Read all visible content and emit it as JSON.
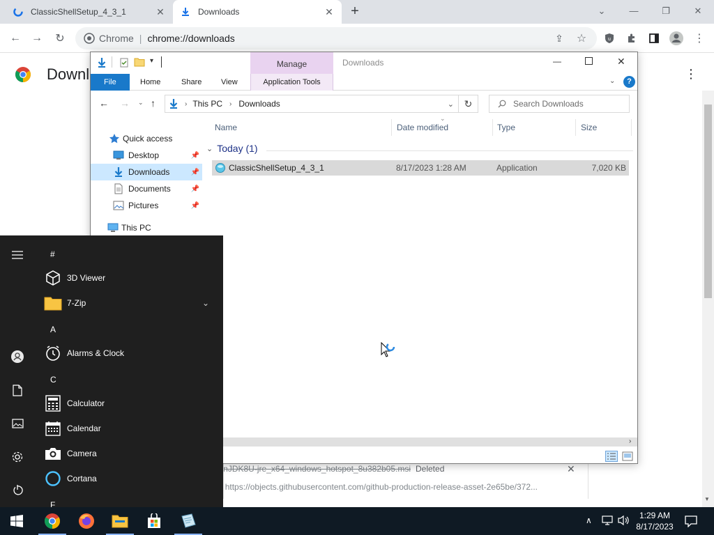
{
  "browser": {
    "tabs": [
      {
        "title": "ClassicShellSetup_4_3_1",
        "icon": "edge-spinner-icon",
        "active": false
      },
      {
        "title": "Downloads",
        "icon": "download-arrow-icon",
        "active": true
      }
    ],
    "new_tab_label": "+",
    "omnibox": {
      "site": "Chrome",
      "url": "chrome://downloads"
    },
    "page_title": "Downloads",
    "download_item": {
      "filename": "OpenJDK8U-jre_x64_windows_hotspot_8u382b05.msi",
      "status": "Deleted",
      "url": "https://objects.githubusercontent.com/github-production-release-asset-2e65be/372..."
    }
  },
  "explorer": {
    "manage_tab": "Manage",
    "title": "Downloads",
    "ribbon_tabs": [
      "File",
      "Home",
      "Share",
      "View",
      "Application Tools"
    ],
    "breadcrumb": [
      "This PC",
      "Downloads"
    ],
    "search_placeholder": "Search Downloads",
    "nav": [
      {
        "label": "Quick access",
        "icon": "star-icon",
        "pinned": false
      },
      {
        "label": "Desktop",
        "icon": "desktop-folder-icon",
        "pinned": true
      },
      {
        "label": "Downloads",
        "icon": "downloads-folder-icon",
        "pinned": true,
        "selected": true
      },
      {
        "label": "Documents",
        "icon": "documents-folder-icon",
        "pinned": true
      },
      {
        "label": "Pictures",
        "icon": "pictures-folder-icon",
        "pinned": true
      },
      {
        "label": "This PC",
        "icon": "computer-icon",
        "pinned": false
      }
    ],
    "columns": [
      "Name",
      "Date modified",
      "Type",
      "Size"
    ],
    "group": "Today (1)",
    "files": [
      {
        "name": "ClassicShellSetup_4_3_1",
        "date": "8/17/2023 1:28 AM",
        "type": "Application",
        "size": "7,020 KB"
      }
    ]
  },
  "start_menu": {
    "sections": [
      {
        "letter": "#",
        "apps": [
          {
            "label": "3D Viewer",
            "icon": "cube-icon"
          },
          {
            "label": "7-Zip",
            "icon": "folder-icon",
            "expandable": true
          }
        ]
      },
      {
        "letter": "A",
        "apps": [
          {
            "label": "Alarms & Clock",
            "icon": "clock-icon"
          }
        ]
      },
      {
        "letter": "C",
        "apps": [
          {
            "label": "Calculator",
            "icon": "calculator-icon"
          },
          {
            "label": "Calendar",
            "icon": "calendar-icon"
          },
          {
            "label": "Camera",
            "icon": "camera-icon"
          },
          {
            "label": "Cortana",
            "icon": "cortana-ring-icon"
          }
        ]
      },
      {
        "letter": "F",
        "apps": []
      }
    ]
  },
  "taskbar": {
    "time": "1:29 AM",
    "date": "8/17/2023"
  },
  "colors": {
    "accent": "#1979ca",
    "manage_tab": "#e9d3f0",
    "selection": "#cce8ff",
    "start_bg": "#1f1f1f",
    "taskbar_bg": "#0f1a24"
  }
}
